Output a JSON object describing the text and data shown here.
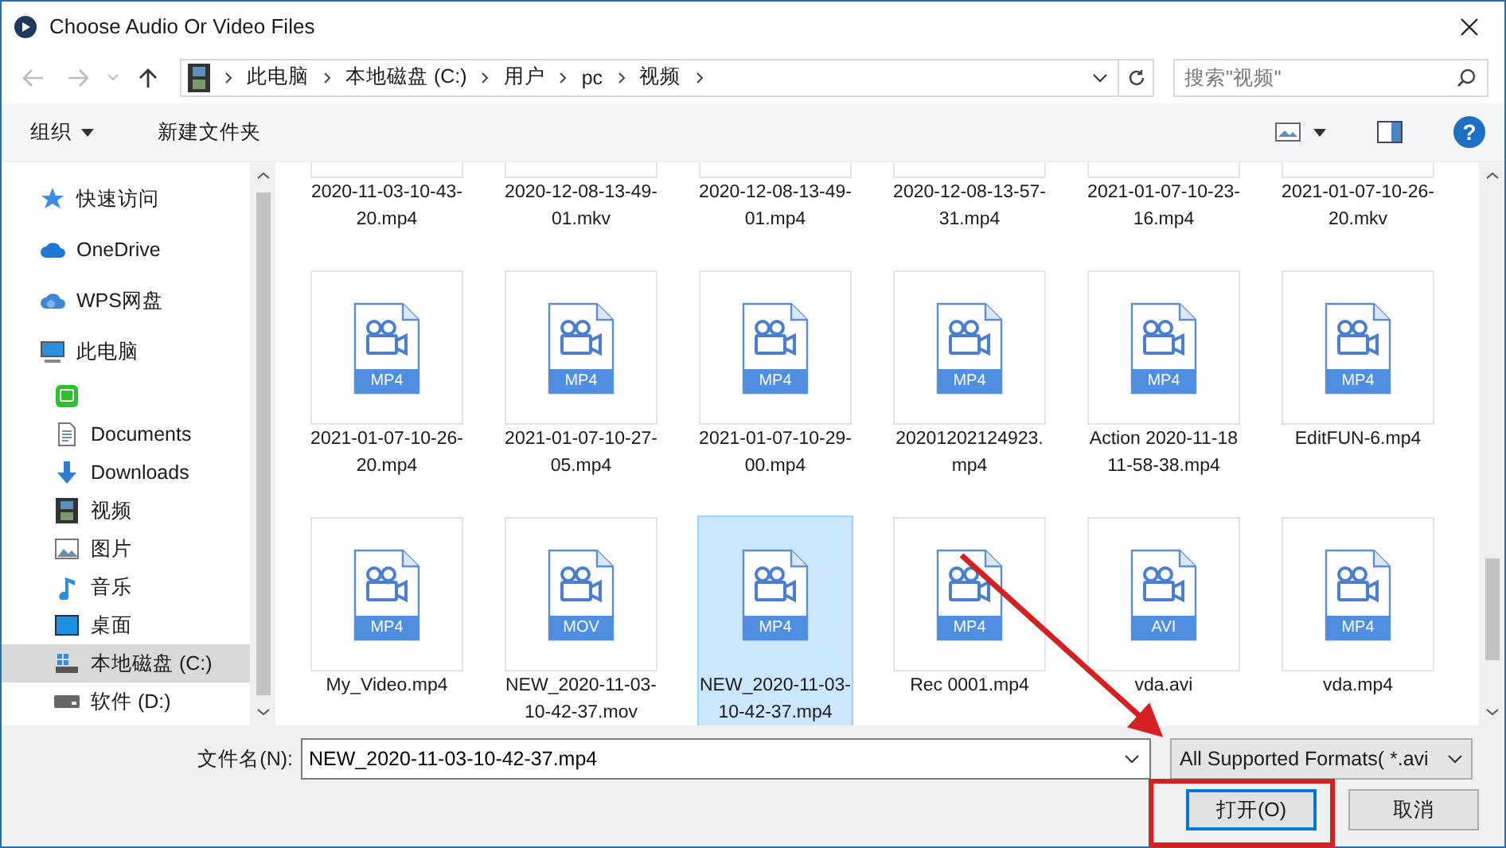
{
  "window": {
    "title": "Choose Audio Or Video Files"
  },
  "address": {
    "segments": [
      "此电脑",
      "本地磁盘 (C:)",
      "用户",
      "pc",
      "视频"
    ]
  },
  "search": {
    "placeholder": "搜索\"视频\""
  },
  "commands": {
    "organize": "组织",
    "new_folder": "新建文件夹",
    "help": "?"
  },
  "sidebar": {
    "items": [
      {
        "label": "快速访问",
        "kind": "star",
        "selected": false
      },
      {
        "label": "OneDrive",
        "kind": "cloud",
        "selected": false
      },
      {
        "label": "WPS网盘",
        "kind": "cloud2",
        "selected": false
      },
      {
        "label": "此电脑",
        "kind": "pc",
        "selected": false,
        "children": [
          {
            "kind": "app",
            "selected": false
          },
          {
            "label": "Documents",
            "kind": "doc",
            "selected": false
          },
          {
            "label": "Downloads",
            "kind": "down",
            "selected": false
          },
          {
            "label": "视频",
            "kind": "film",
            "selected": false
          },
          {
            "label": "图片",
            "kind": "pic",
            "selected": false
          },
          {
            "label": "音乐",
            "kind": "music",
            "selected": false
          },
          {
            "label": "桌面",
            "kind": "desk",
            "selected": false
          },
          {
            "label": "本地磁盘 (C:)",
            "kind": "sysdrive",
            "selected": true
          },
          {
            "label": "软件 (D:)",
            "kind": "drive",
            "selected": false
          }
        ]
      }
    ]
  },
  "files": [
    {
      "name": "2020-11-03-10-43-20.mp4",
      "selected": false
    },
    {
      "name": "2020-12-08-13-49-01.mkv",
      "selected": false
    },
    {
      "name": "2020-12-08-13-49-01.mp4",
      "selected": false
    },
    {
      "name": "2020-12-08-13-57-31.mp4",
      "selected": false
    },
    {
      "name": "2021-01-07-10-23-16.mp4",
      "selected": false
    },
    {
      "name": "2021-01-07-10-26-20.mkv",
      "selected": false
    },
    {
      "name": "2021-01-07-10-26-20.mp4",
      "badge": "MP4",
      "selected": false
    },
    {
      "name": "2021-01-07-10-27-05.mp4",
      "badge": "MP4",
      "selected": false
    },
    {
      "name": "2021-01-07-10-29-00.mp4",
      "badge": "MP4",
      "selected": false
    },
    {
      "name": "20201202124923.mp4",
      "badge": "MP4",
      "selected": false
    },
    {
      "name": "Action 2020-11-18 11-58-38.mp4",
      "badge": "MP4",
      "selected": false
    },
    {
      "name": "EditFUN-6.mp4",
      "badge": "MP4",
      "selected": false
    },
    {
      "name": "My_Video.mp4",
      "badge": "MP4",
      "selected": false
    },
    {
      "name": "NEW_2020-11-03-10-42-37.mov",
      "badge": "MOV",
      "selected": false
    },
    {
      "name": "NEW_2020-11-03-10-42-37.mp4",
      "badge": "MP4",
      "selected": true
    },
    {
      "name": "Rec 0001.mp4",
      "badge": "MP4",
      "selected": false
    },
    {
      "name": "vda.avi",
      "badge": "AVI",
      "selected": false
    },
    {
      "name": "vda.mp4",
      "badge": "MP4",
      "selected": false
    }
  ],
  "footer": {
    "filename_label": "文件名(N):",
    "filename": "NEW_2020-11-03-10-42-37.mp4",
    "filter": "All Supported Formats( *.avi",
    "open": "打开(O)",
    "cancel": "取消"
  }
}
